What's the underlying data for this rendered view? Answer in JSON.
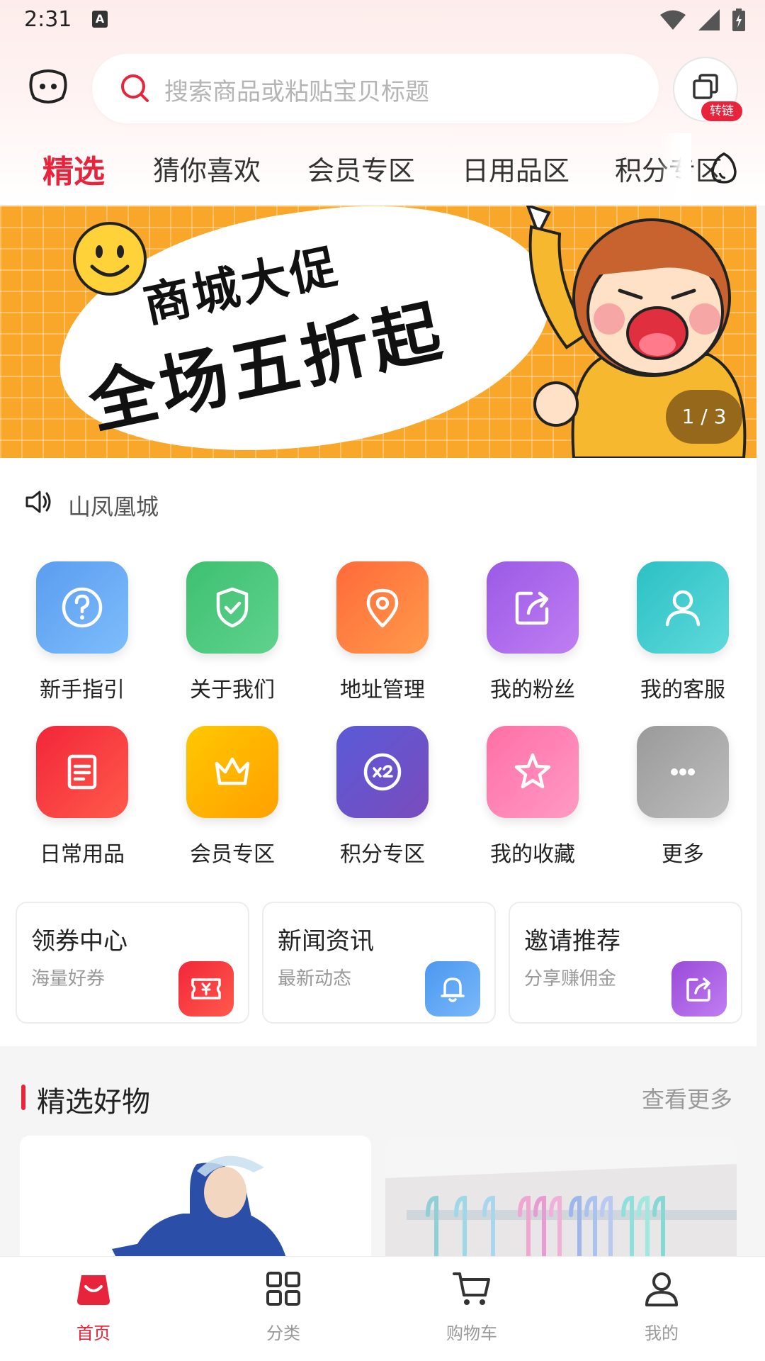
{
  "status_bar": {
    "time": "2:31",
    "notif_letter": "A"
  },
  "header": {
    "search_placeholder": "搜索商品或粘贴宝贝标题",
    "convert_badge": "转链"
  },
  "tabs": [
    "精选",
    "猜你喜欢",
    "会员专区",
    "日用品区",
    "积分专区"
  ],
  "banner": {
    "title_line1": "商城大促",
    "title_line2": "全场五折起",
    "counter": "1 / 3"
  },
  "notice": {
    "text": "山凤凰城"
  },
  "grid": [
    {
      "label": "新手指引",
      "icon": "question-icon",
      "color": "#6aa8f5"
    },
    {
      "label": "关于我们",
      "icon": "shield-check-icon",
      "color": "#4fc77f"
    },
    {
      "label": "地址管理",
      "icon": "location-pin-icon",
      "color": "#ff7a3d"
    },
    {
      "label": "我的粉丝",
      "icon": "share-icon",
      "color": "#a874e8"
    },
    {
      "label": "我的客服",
      "icon": "user-icon",
      "color": "#3cc9c9"
    },
    {
      "label": "日常用品",
      "icon": "document-icon",
      "color": "#f2343f"
    },
    {
      "label": "会员专区",
      "icon": "crown-icon",
      "color": "#ffb000"
    },
    {
      "label": "积分专区",
      "icon": "points-x2-icon",
      "color": "#6c59c9"
    },
    {
      "label": "我的收藏",
      "icon": "star-icon",
      "color": "#ff7eb0"
    },
    {
      "label": "更多",
      "icon": "more-dots-icon",
      "color": "#a9a9a9"
    }
  ],
  "features": [
    {
      "title": "领券中心",
      "sub": "海量好券",
      "icon": "coupon-icon",
      "color": "#f2343f"
    },
    {
      "title": "新闻资讯",
      "sub": "最新动态",
      "icon": "bell-icon",
      "color": "#5aa6f5"
    },
    {
      "title": "邀请推荐",
      "sub": "分享赚佣金",
      "icon": "share-icon",
      "color": "#a05ad8"
    }
  ],
  "section": {
    "title": "精选好物",
    "more": "查看更多"
  },
  "bottom_nav": [
    {
      "label": "首页",
      "icon": "home-bag-icon",
      "active": true
    },
    {
      "label": "分类",
      "icon": "grid-icon",
      "active": false
    },
    {
      "label": "购物车",
      "icon": "cart-icon",
      "active": false
    },
    {
      "label": "我的",
      "icon": "profile-icon",
      "active": false
    }
  ],
  "colors": {
    "accent": "#e8243c",
    "banner_bg": "#f8a72a"
  }
}
